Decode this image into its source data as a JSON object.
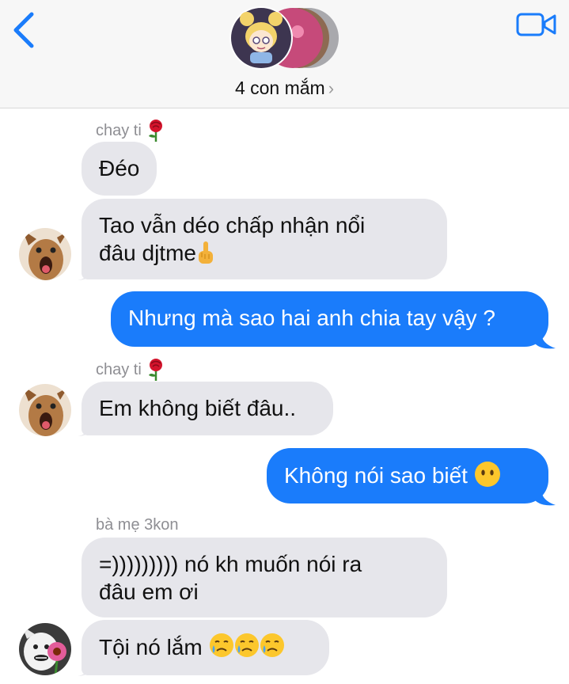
{
  "header": {
    "group_name": "4 con mắm",
    "chevron": "›",
    "back_icon": "chevron-left-icon",
    "video_icon": "video-camera-icon",
    "accent_color": "#1a7cfb"
  },
  "messages": [
    {
      "sender": "chay ti",
      "sender_emoji": "rose-icon"
    },
    {
      "text": "Đéo",
      "direction": "incoming"
    },
    {
      "text_line1": "Tao vẫn déo chấp nhận nổi",
      "text_line2": "đâu djtme",
      "emoji": "middle-finger-icon",
      "direction": "incoming"
    },
    {
      "text": "Nhưng mà sao hai anh chia tay vậy ?",
      "direction": "outgoing"
    },
    {
      "sender": "chay ti",
      "sender_emoji": "rose-icon"
    },
    {
      "text": "Em không biết đâu..",
      "direction": "incoming"
    },
    {
      "text": "Không nói sao biết",
      "emoji": "face-without-mouth-icon",
      "direction": "outgoing"
    },
    {
      "sender": "bà mẹ 3kon"
    },
    {
      "text_line1": "=))))))))) nó kh muốn nói ra",
      "text_line2": "đâu em ơi",
      "direction": "incoming"
    },
    {
      "text": "Tội nó lắm",
      "emojis": [
        "crying-face-icon",
        "crying-face-icon",
        "crying-face-icon"
      ],
      "direction": "incoming"
    }
  ],
  "colors": {
    "incoming_bubble": "#e6e6eb",
    "outgoing_bubble": "#1a7cfb",
    "header_bg": "#f7f7f7"
  }
}
